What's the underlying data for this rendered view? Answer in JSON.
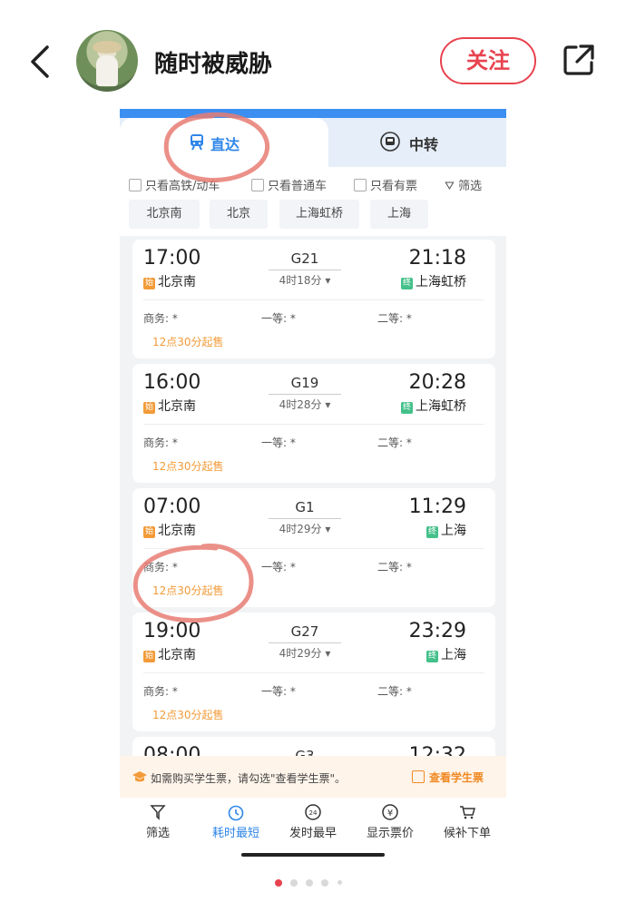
{
  "header": {
    "username": "随时被威胁",
    "follow_label": "关注"
  },
  "tabs": [
    {
      "label": "直达"
    },
    {
      "label": "中转"
    }
  ],
  "filters": {
    "items": [
      "只看高铁/动车",
      "只看普通车",
      "只看有票"
    ],
    "filter_label": "筛选"
  },
  "stations": [
    "北京南",
    "北京",
    "上海虹桥",
    "上海"
  ],
  "trains": [
    {
      "dep_time": "17:00",
      "dep_station": "北京南",
      "train_no": "G21",
      "duration": "4时18分",
      "arr_time": "21:18",
      "arr_station": "上海虹桥",
      "seat1": "商务: *",
      "seat2": "一等: *",
      "seat3": "二等: *",
      "sale": "12点30分起售"
    },
    {
      "dep_time": "16:00",
      "dep_station": "北京南",
      "train_no": "G19",
      "duration": "4时28分",
      "arr_time": "20:28",
      "arr_station": "上海虹桥",
      "seat1": "商务: *",
      "seat2": "一等: *",
      "seat3": "二等: *",
      "sale": "12点30分起售"
    },
    {
      "dep_time": "07:00",
      "dep_station": "北京南",
      "train_no": "G1",
      "duration": "4时29分",
      "arr_time": "11:29",
      "arr_station": "上海",
      "seat1": "商务: *",
      "seat2": "一等: *",
      "seat3": "二等: *",
      "sale": "12点30分起售"
    },
    {
      "dep_time": "19:00",
      "dep_station": "北京南",
      "train_no": "G27",
      "duration": "4时29分",
      "arr_time": "23:29",
      "arr_station": "上海",
      "seat1": "商务: *",
      "seat2": "一等: *",
      "seat3": "二等: *",
      "sale": "12点30分起售"
    },
    {
      "dep_time": "08:00",
      "train_no": "G3",
      "arr_time": "12:32"
    }
  ],
  "tags": {
    "start": "始",
    "end": "终"
  },
  "notice": {
    "text": "如需购买学生票，请勾选\"查看学生票\"。",
    "check_label": "查看学生票"
  },
  "bottom_bar": [
    "筛选",
    "耗时最短",
    "发时最早",
    "显示票价",
    "候补下单"
  ],
  "colors": {
    "accent_blue": "#2f86e8",
    "follow_red": "#e8434f",
    "sale_orange": "#f29b38",
    "scribble_red": "#e87d73"
  },
  "pager": {
    "count": 5,
    "active": 1
  }
}
